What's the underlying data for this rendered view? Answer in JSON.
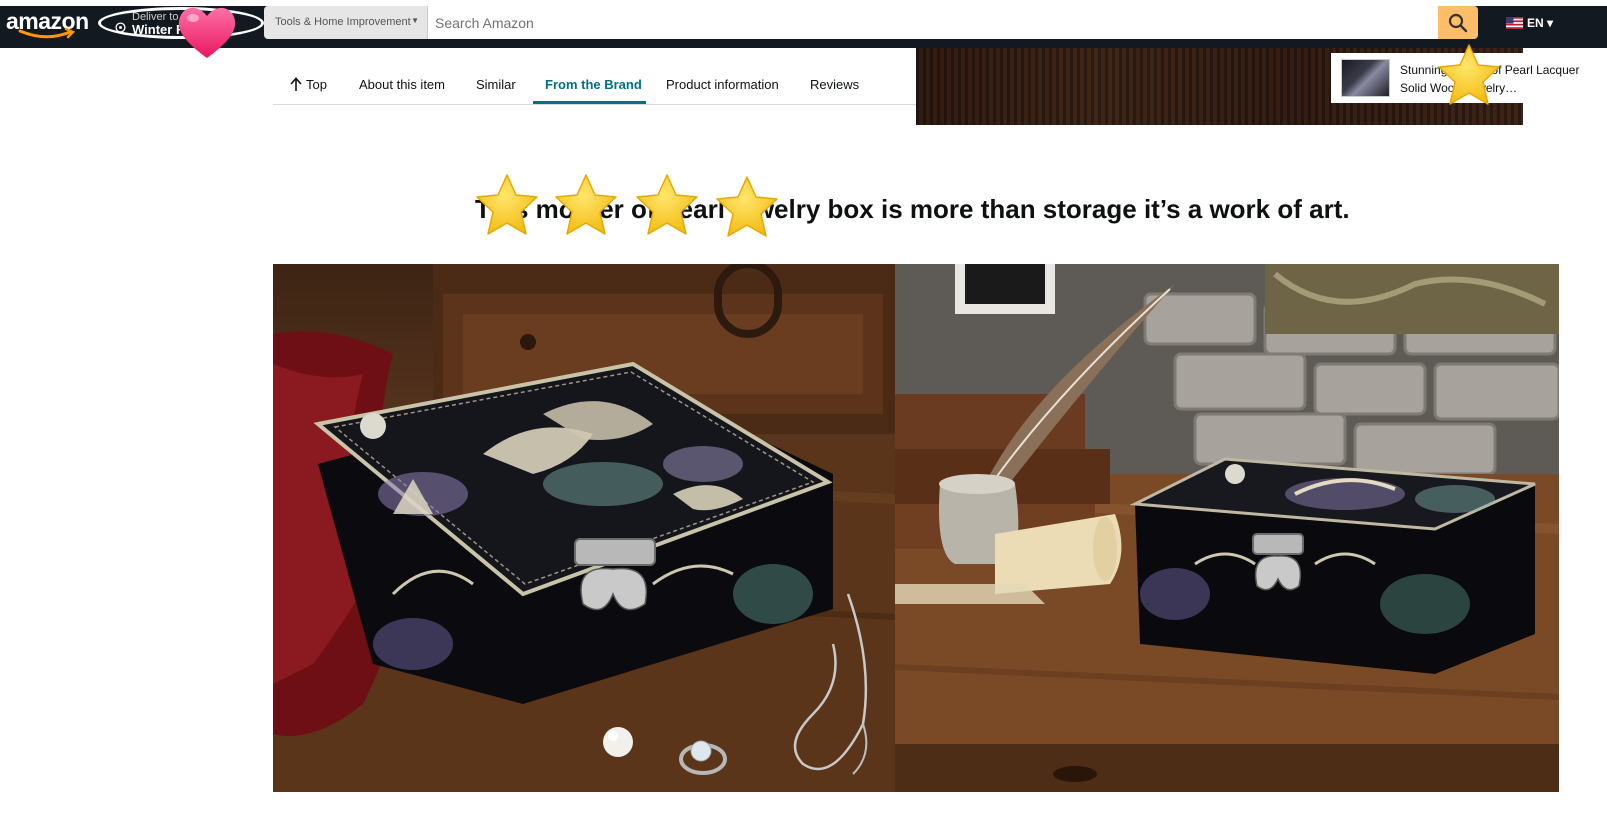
{
  "header": {
    "logo_text": "amazon",
    "deliver_line1": "Deliver to",
    "deliver_line2": "Winter F",
    "search_category": "Tools & Home Improvement",
    "search_placeholder": "Search Amazon",
    "language": "EN"
  },
  "subnav": {
    "tabs": [
      {
        "label": "Top"
      },
      {
        "label": "About this item"
      },
      {
        "label": "Similar"
      },
      {
        "label": "From the Brand"
      },
      {
        "label": "Product information"
      },
      {
        "label": "Reviews"
      }
    ],
    "active_tab": "From the Brand"
  },
  "mini_product": {
    "title": "Stunning Mother of Pearl Lacquer Solid Wood Jewelry…"
  },
  "main": {
    "headline": "This mother of pearl jewelry box is more than storage it’s a work of art."
  },
  "colors": {
    "header_bg": "#131921",
    "search_button": "#febd69",
    "active_tab": "#007185"
  },
  "icons": {
    "search": "magnifier-icon",
    "location": "map-pin-icon",
    "top": "up-arrow-icon",
    "flag": "us-flag-icon",
    "sticker_heart": "heart-icon",
    "sticker_star": "star-icon"
  }
}
